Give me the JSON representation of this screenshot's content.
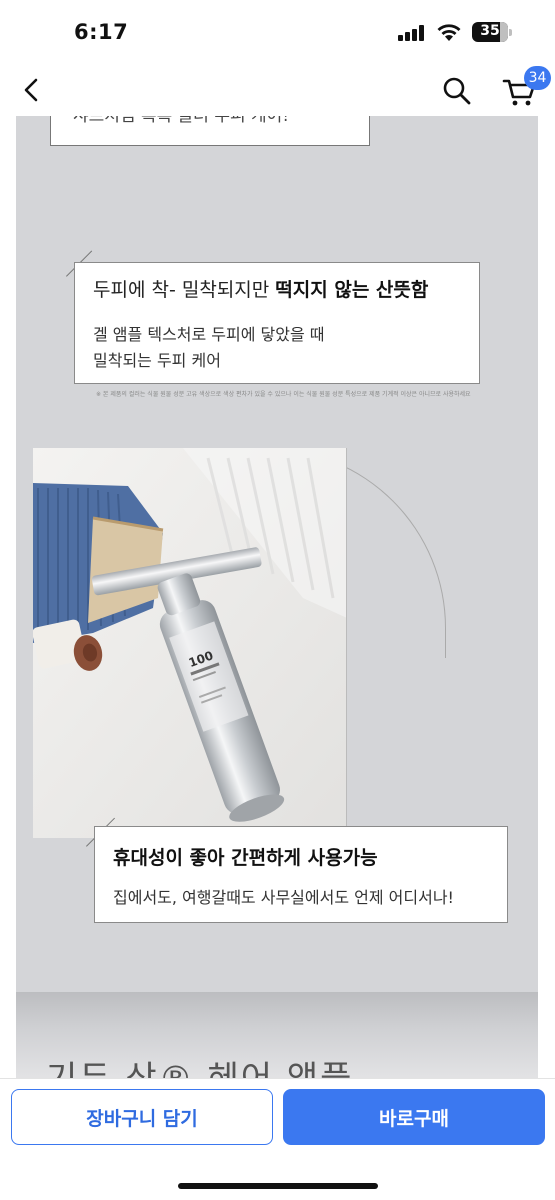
{
  "status_bar": {
    "time": "6:17",
    "battery": "35"
  },
  "nav": {
    "back_icon": "chevron-left-icon",
    "search_icon": "search-icon",
    "cart_icon": "cart-icon",
    "cart_count": "34"
  },
  "content": {
    "caption_top": "샤프처럼 톡톡 눌러 두피 케어!",
    "card_1": {
      "title_regular": "두피에 착- 밀착되지만 ",
      "title_bold": "떡지지 않는 산뜻함",
      "line_1": "겔 앰플 텍스처로 두피에 닿았을 때",
      "line_2": "밀착되는 두피 케어"
    },
    "fine_print": "※ 본 제품의 컬러는 식물 원물 성분 고유 색상으로 색상 편차가 있을 수 있으나 이는 식물 원물 성분 특성으로 제품 기계적 이상은 아니므로 사용하세요",
    "card_2": {
      "title": "휴대성이 좋아 간편하게 사용가능",
      "line_1": "집에서도, 여행갈때도 사무실에서도 언제 어디서나!"
    },
    "product_label": "100",
    "teaser": "기두 상® 헤어 앰플"
  },
  "bottom_bar": {
    "cart_button": "장바구니 담기",
    "buy_button": "바로구매"
  },
  "colors": {
    "accent": "#3b78f0",
    "content_bg": "#d4d5d8"
  }
}
